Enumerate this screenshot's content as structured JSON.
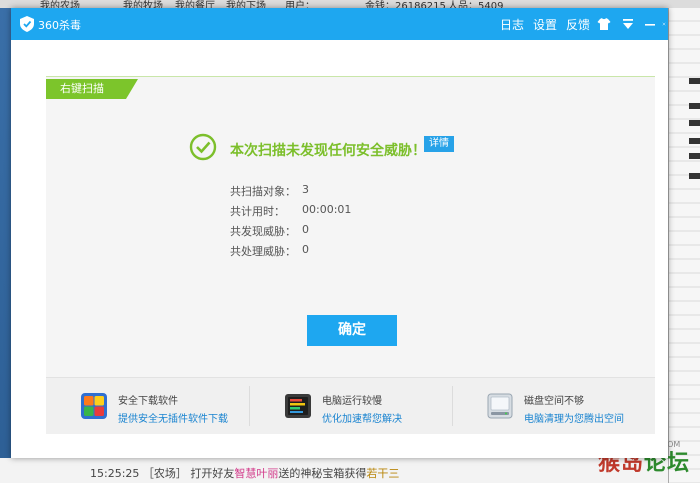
{
  "background": {
    "top_tabs": [
      "我的农场",
      "我的牧场",
      "我的餐厅",
      "我的下场",
      "用户：",
      "金钱：26186215",
      "人品：5409"
    ],
    "bottom_time": "15:25:25",
    "bottom_text_a": "［农场］ 打开好友",
    "bottom_text_b": "智慧叶丽",
    "bottom_text_c": "送的神秘宝箱获得",
    "bottom_text_d": "若干三",
    "watermark_a": "猴岛",
    "watermark_b": "论坛",
    "watermark_url": "BBS.HOUDAO.COM"
  },
  "window": {
    "title": "360杀毒",
    "menu": [
      "日志",
      "设置",
      "反馈"
    ],
    "icons": [
      "shirt-icon",
      "menu-icon",
      "minimize-icon",
      "close-icon"
    ]
  },
  "panel": {
    "tag": "右键扫描",
    "result": "本次扫描未发现任何安全威胁！",
    "detail": "详情",
    "stats": [
      {
        "label": "共扫描对象：",
        "value": "3"
      },
      {
        "label": "共计用时：",
        "value": "00:00:01"
      },
      {
        "label": "共发现威胁：",
        "value": "0"
      },
      {
        "label": "共处理威胁：",
        "value": "0"
      }
    ],
    "ok": "确定"
  },
  "recommendations": [
    {
      "title": "安全下载软件",
      "link": "提供安全无插件软件下载",
      "icon": "software-grid-icon"
    },
    {
      "title": "电脑运行较慢",
      "link": "优化加速帮您解决",
      "icon": "speed-monitor-icon"
    },
    {
      "title": "磁盘空间不够",
      "link": "电脑清理为您腾出空间",
      "icon": "disk-cleanup-icon"
    }
  ],
  "colors": {
    "titlebar": "#1ea7f0",
    "tag": "#7cc52b",
    "success": "#7cbf2b",
    "link": "#1a84d0"
  }
}
